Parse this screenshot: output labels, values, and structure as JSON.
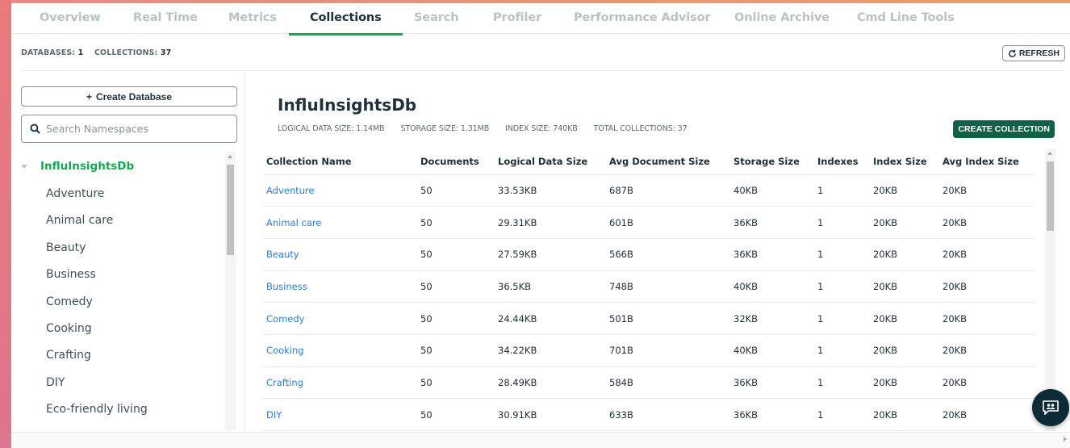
{
  "tabs": [
    {
      "label": "Overview",
      "active": false
    },
    {
      "label": "Real Time",
      "active": false
    },
    {
      "label": "Metrics",
      "active": false
    },
    {
      "label": "Collections",
      "active": true
    },
    {
      "label": "Search",
      "active": false
    },
    {
      "label": "Profiler",
      "active": false
    },
    {
      "label": "Performance Advisor",
      "active": false
    },
    {
      "label": "Online Archive",
      "active": false
    },
    {
      "label": "Cmd Line Tools",
      "active": false
    }
  ],
  "summary": {
    "databases_label": "DATABASES:",
    "databases_count": "1",
    "collections_label": "COLLECTIONS:",
    "collections_count": "37",
    "refresh_label": "REFRESH"
  },
  "sidebar": {
    "create_db_label": "Create Database",
    "search_placeholder": "Search Namespaces",
    "database": "InfluInsightsDb",
    "collections": [
      "Adventure",
      "Animal care",
      "Beauty",
      "Business",
      "Comedy",
      "Cooking",
      "Crafting",
      "DIY",
      "Eco-friendly living"
    ]
  },
  "main": {
    "db_title": "InfluInsightsDb",
    "stats": [
      "LOGICAL DATA SIZE: 1.14MB",
      "STORAGE SIZE: 1.31MB",
      "INDEX SIZE: 740KB",
      "TOTAL COLLECTIONS: 37"
    ],
    "create_collection_label": "CREATE COLLECTION",
    "columns": [
      "Collection Name",
      "Documents",
      "Logical Data Size",
      "Avg Document Size",
      "Storage Size",
      "Indexes",
      "Index Size",
      "Avg Index Size"
    ],
    "rows": [
      [
        "Adventure",
        "50",
        "33.53KB",
        "687B",
        "40KB",
        "1",
        "20KB",
        "20KB"
      ],
      [
        "Animal care",
        "50",
        "29.31KB",
        "601B",
        "36KB",
        "1",
        "20KB",
        "20KB"
      ],
      [
        "Beauty",
        "50",
        "27.59KB",
        "566B",
        "36KB",
        "1",
        "20KB",
        "20KB"
      ],
      [
        "Business",
        "50",
        "36.5KB",
        "748B",
        "40KB",
        "1",
        "20KB",
        "20KB"
      ],
      [
        "Comedy",
        "50",
        "24.44KB",
        "501B",
        "32KB",
        "1",
        "20KB",
        "20KB"
      ],
      [
        "Cooking",
        "50",
        "34.22KB",
        "701B",
        "40KB",
        "1",
        "20KB",
        "20KB"
      ],
      [
        "Crafting",
        "50",
        "28.49KB",
        "584B",
        "36KB",
        "1",
        "20KB",
        "20KB"
      ],
      [
        "DIY",
        "50",
        "30.91KB",
        "633B",
        "36KB",
        "1",
        "20KB",
        "20KB"
      ]
    ]
  },
  "colors": {
    "accent_green": "#13aa52",
    "link_blue": "#2c7cd6",
    "button_dark_green": "#116149"
  }
}
